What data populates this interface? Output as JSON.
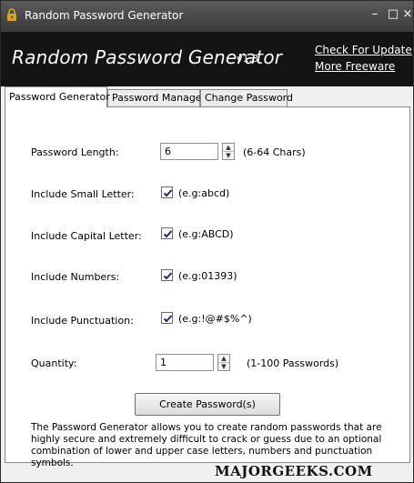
{
  "window": {
    "title": "Random Password Generator",
    "controls": {
      "minimize": "–",
      "maximize": "□",
      "close": "×"
    }
  },
  "banner": {
    "title": "Random Password Generator",
    "version": "v1.3",
    "link_update": "Check For Update",
    "link_freeware": "More Freeware"
  },
  "tabs": [
    {
      "label": "Password Generator",
      "active": true
    },
    {
      "label": "Password Manager",
      "active": false
    },
    {
      "label": "Change Password",
      "active": false
    }
  ],
  "form": {
    "password_length": {
      "label": "Password Length:",
      "value": "6",
      "hint": "(6-64 Chars)"
    },
    "small_letter": {
      "label": "Include Small Letter:",
      "checked": true,
      "hint": "(e.g:abcd)"
    },
    "capital_letter": {
      "label": "Include Capital Letter:",
      "checked": true,
      "hint": "(e.g:ABCD)"
    },
    "numbers": {
      "label": "Include Numbers:",
      "checked": true,
      "hint": "(e.g:01393)"
    },
    "punctuation": {
      "label": "Include Punctuation:",
      "checked": true,
      "hint": "(e.g:!@#$%^)"
    },
    "quantity": {
      "label": "Quantity:",
      "value": "1",
      "hint": "(1-100 Passwords)"
    },
    "create_button": "Create Password(s)"
  },
  "description": "The Password Generator allows you to create random passwords that are highly secure and extremely difficult to crack or guess due to an optional combination of lower and upper case letters, numbers and punctuation symbols.",
  "watermark": "MAJORGEEKS.COM",
  "icons": {
    "window_icon": "lock-icon",
    "checkbox_mark": "checkmark-icon",
    "spin_up": "arrow-up-icon",
    "spin_down": "arrow-down-icon"
  },
  "colors": {
    "banner_bg": "#141414",
    "titlebar_bg": "#4a4a4a",
    "lock_icon": "#d9a520",
    "checkmark": "#1a2a6a"
  }
}
